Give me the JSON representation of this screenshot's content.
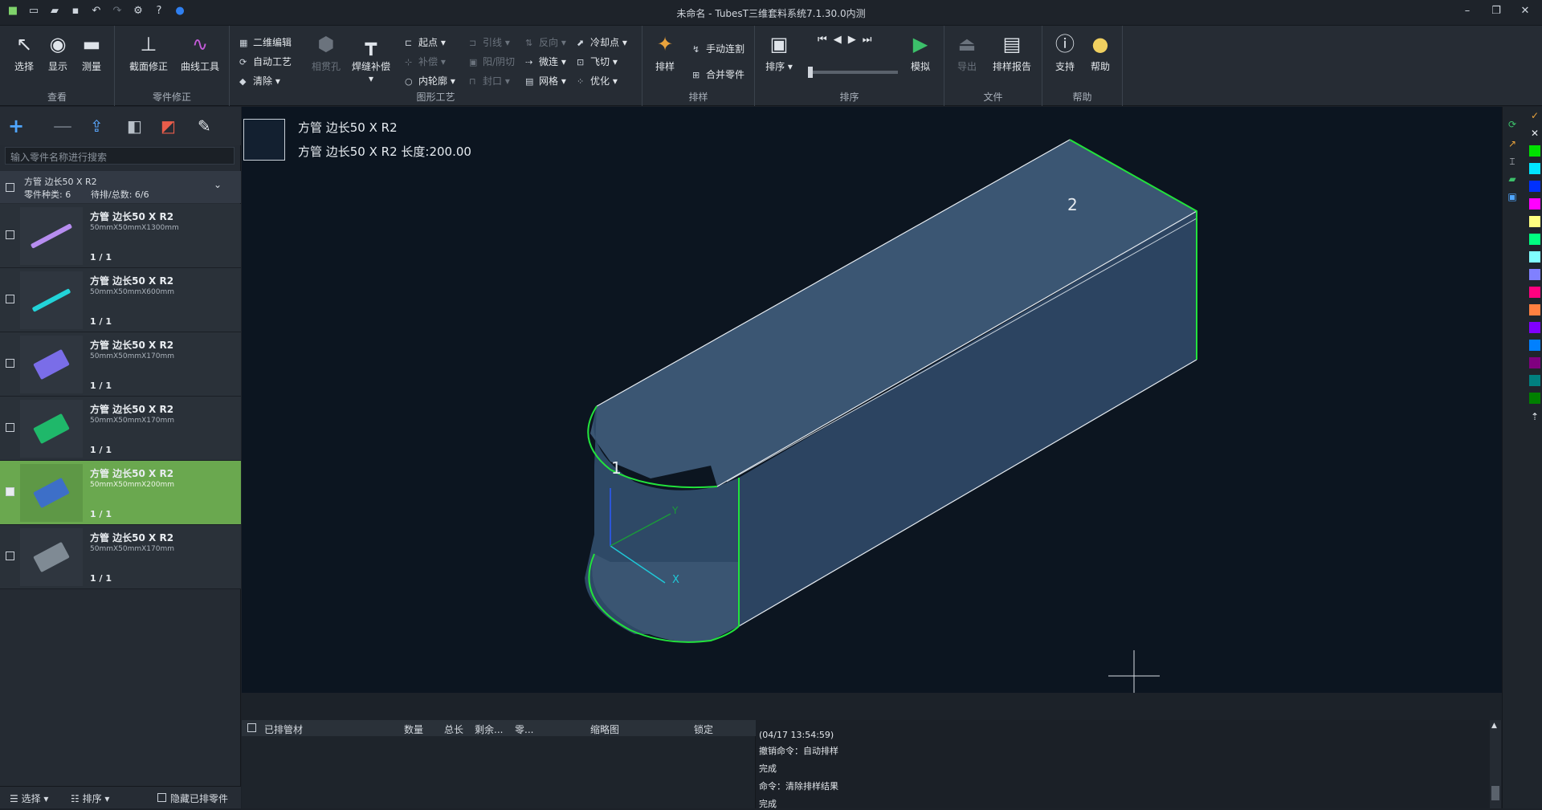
{
  "titlebar": {
    "title": "未命名 - TubesT三维套料系统7.1.30.0内测"
  },
  "ribbon": {
    "groups": [
      {
        "label": "查看",
        "buttons": [
          "选择",
          "显示",
          "测量"
        ]
      },
      {
        "label": "零件修正",
        "buttons": [
          "截面修正",
          "曲线工具"
        ]
      },
      {
        "label": "图形工艺",
        "buttons": [
          "相贯孔",
          "焊缝补偿"
        ],
        "small": [
          "二维编辑",
          "自动工艺",
          "清除",
          "起点",
          "补偿",
          "内轮廓",
          "引线",
          "阳/阴切",
          "封口",
          "反向",
          "微连",
          "网格",
          "冷却点",
          "飞切",
          "优化"
        ]
      },
      {
        "label": "排样",
        "buttons": [
          "排样"
        ],
        "small": [
          "手动连割",
          "合并零件"
        ]
      },
      {
        "label": "排序",
        "buttons": [
          "排序",
          "模拟"
        ]
      },
      {
        "label": "文件",
        "buttons": [
          "导出",
          "排样报告"
        ]
      },
      {
        "label": "帮助",
        "buttons": [
          "支持",
          "帮助"
        ]
      }
    ]
  },
  "left": {
    "search_placeholder": "输入零件名称进行搜索",
    "group": {
      "name": "方管 边长50 X R2",
      "kinds": "零件种类: 6",
      "pending": "待排/总数: 6/6"
    },
    "parts": [
      {
        "name": "方管 边长50 X R2",
        "dims": "50mmX50mmX1300mm",
        "count": "1 / 1",
        "color": "#b78df0"
      },
      {
        "name": "方管 边长50 X R2",
        "dims": "50mmX50mmX600mm",
        "count": "1 / 1",
        "color": "#22d3d8"
      },
      {
        "name": "方管 边长50 X R2",
        "dims": "50mmX50mmX170mm",
        "count": "1 / 1",
        "color": "#7a6de8"
      },
      {
        "name": "方管 边长50 X R2",
        "dims": "50mmX50mmX170mm",
        "count": "1 / 1",
        "color": "#1fb86a"
      },
      {
        "name": "方管 边长50 X R2",
        "dims": "50mmX50mmX200mm",
        "count": "1 / 1",
        "color": "#3d6fc8"
      },
      {
        "name": "方管 边长50 X R2",
        "dims": "50mmX50mmX170mm",
        "count": "1 / 1",
        "color": "#7f8a94"
      }
    ],
    "bottom": {
      "select": "选择",
      "sort": "排序",
      "hide": "隐藏已排零件"
    }
  },
  "viewport": {
    "info_line1": "方管 边长50 X R2",
    "info_line2": "方管 边长50 X R2 长度:200.00",
    "label1": "1",
    "label2": "2",
    "axis_x": "X",
    "axis_y": "Y"
  },
  "table": {
    "headers": [
      "已排管材",
      "数量",
      "总长",
      "剩余...",
      "零...",
      "缩略图",
      "锁定"
    ]
  },
  "log": [
    "(04/17 13:54:59)",
    "撤销命令：自动排样",
    "完成",
    "命令：清除排样结果",
    "完成"
  ],
  "swatches": [
    "#00e000",
    "#00e5ff",
    "#0030ff",
    "#ff00ff",
    "#ffff80",
    "#00ff80",
    "#80ffff",
    "#8080ff",
    "#ff0080",
    "#ff8040",
    "#8000ff",
    "#0080ff",
    "#800080",
    "#008080",
    "#008000"
  ]
}
